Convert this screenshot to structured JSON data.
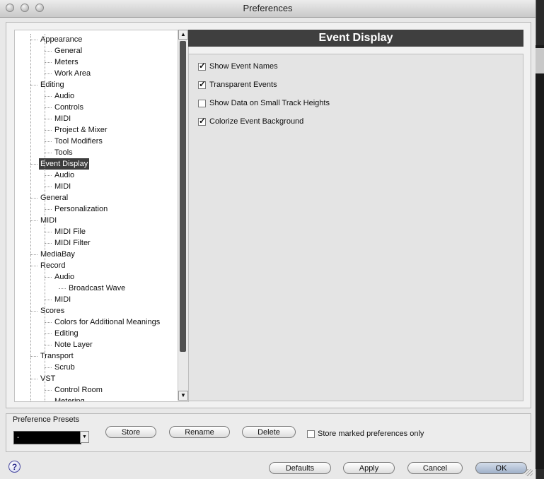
{
  "window": {
    "title": "Preferences"
  },
  "tree": {
    "items": [
      {
        "label": "Appearance",
        "level": 0
      },
      {
        "label": "General",
        "level": 1
      },
      {
        "label": "Meters",
        "level": 1
      },
      {
        "label": "Work Area",
        "level": 1
      },
      {
        "label": "Editing",
        "level": 0
      },
      {
        "label": "Audio",
        "level": 1
      },
      {
        "label": "Controls",
        "level": 1
      },
      {
        "label": "MIDI",
        "level": 1
      },
      {
        "label": "Project & Mixer",
        "level": 1
      },
      {
        "label": "Tool Modifiers",
        "level": 1
      },
      {
        "label": "Tools",
        "level": 1
      },
      {
        "label": "Event Display",
        "level": 0,
        "selected": true
      },
      {
        "label": "Audio",
        "level": 1
      },
      {
        "label": "MIDI",
        "level": 1
      },
      {
        "label": "General",
        "level": 0
      },
      {
        "label": "Personalization",
        "level": 1
      },
      {
        "label": "MIDI",
        "level": 0
      },
      {
        "label": "MIDI File",
        "level": 1
      },
      {
        "label": "MIDI Filter",
        "level": 1
      },
      {
        "label": "MediaBay",
        "level": 0
      },
      {
        "label": "Record",
        "level": 0
      },
      {
        "label": "Audio",
        "level": 1
      },
      {
        "label": "Broadcast Wave",
        "level": 2
      },
      {
        "label": "MIDI",
        "level": 1
      },
      {
        "label": "Scores",
        "level": 0
      },
      {
        "label": "Colors for Additional Meanings",
        "level": 1
      },
      {
        "label": "Editing",
        "level": 1
      },
      {
        "label": "Note Layer",
        "level": 1
      },
      {
        "label": "Transport",
        "level": 0
      },
      {
        "label": "Scrub",
        "level": 1
      },
      {
        "label": "VST",
        "level": 0
      },
      {
        "label": "Control Room",
        "level": 1
      },
      {
        "label": "Metering",
        "level": 1
      }
    ]
  },
  "panel": {
    "title": "Event Display",
    "options": [
      {
        "label": "Show Event Names",
        "checked": true
      },
      {
        "label": "Transparent Events",
        "checked": true
      },
      {
        "label": "Show Data on Small Track Heights",
        "checked": false
      },
      {
        "label": "Colorize Event Background",
        "checked": true
      }
    ]
  },
  "presets": {
    "label": "Preference Presets",
    "selected": "-",
    "store": "Store",
    "rename": "Rename",
    "delete": "Delete",
    "store_marked_label": "Store marked preferences only",
    "store_marked_checked": false
  },
  "footer": {
    "help": "?",
    "defaults": "Defaults",
    "apply": "Apply",
    "cancel": "Cancel",
    "ok": "OK"
  }
}
